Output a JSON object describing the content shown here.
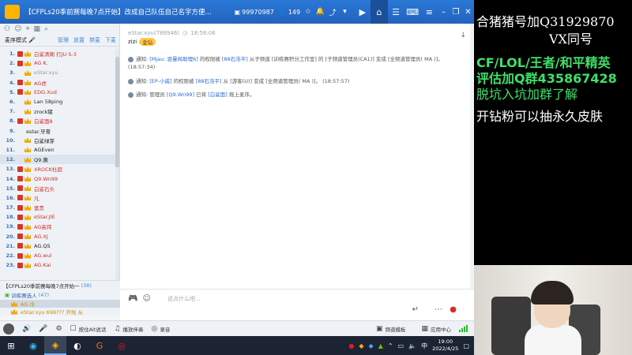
{
  "titlebar": {
    "title": "【CFPLs20季前赛每晚7点开始】改成自己队伍自己名字方便...",
    "channel_id": "99970987",
    "users": "149"
  },
  "left": {
    "mode_label": "麦序模式",
    "actions": [
      "管理",
      "放置",
      "禁麦",
      "下麦"
    ],
    "members": [
      {
        "num": "1.",
        "badge": true,
        "crown": true,
        "name": "白鲨清阁 打JU S-3",
        "color": "red"
      },
      {
        "num": "2.",
        "badge": true,
        "crown": true,
        "name": "AG K.",
        "color": "red"
      },
      {
        "num": "3.",
        "badge": false,
        "crown": true,
        "name": "eStar.xyu",
        "color": "gry"
      },
      {
        "num": "4.",
        "badge": true,
        "crown": true,
        "name": "AG虎",
        "color": "red"
      },
      {
        "num": "5.",
        "badge": true,
        "crown": true,
        "name": "EDG.Xud",
        "color": "red"
      },
      {
        "num": "6.",
        "badge": false,
        "crown": true,
        "name": "Lan 58ping",
        "color": "blk"
      },
      {
        "num": "7.",
        "badge": false,
        "crown": true,
        "name": "zrock猪",
        "color": "blk"
      },
      {
        "num": "8.",
        "badge": true,
        "crown": true,
        "name": "白鲨面8",
        "color": "red"
      },
      {
        "num": "9.",
        "badge": false,
        "crown": false,
        "name": "estar.牙膏",
        "color": "blk",
        "indent": true
      },
      {
        "num": "10.",
        "badge": false,
        "crown": true,
        "name": "白鲨绿芽",
        "color": "blk"
      },
      {
        "num": "11.",
        "badge": false,
        "crown": true,
        "name": "AGEven",
        "color": "blk"
      },
      {
        "num": "12.",
        "badge": false,
        "crown": true,
        "name": "Q9.黄",
        "color": "blk",
        "sel": true
      },
      {
        "num": "13.",
        "badge": true,
        "crown": true,
        "name": "XROCK杜超",
        "color": "red"
      },
      {
        "num": "14.",
        "badge": true,
        "crown": true,
        "name": "Q9.Wn99",
        "color": "red"
      },
      {
        "num": "15.",
        "badge": true,
        "crown": true,
        "name": "白鲨石头",
        "color": "red"
      },
      {
        "num": "16.",
        "badge": true,
        "crown": true,
        "name": "凡",
        "color": "red"
      },
      {
        "num": "17.",
        "badge": true,
        "crown": true,
        "name": "富贵",
        "color": "red"
      },
      {
        "num": "18.",
        "badge": true,
        "crown": true,
        "name": "eStar.JIE",
        "color": "red"
      },
      {
        "num": "19.",
        "badge": true,
        "crown": true,
        "name": "AG高炜",
        "color": "red"
      },
      {
        "num": "20.",
        "badge": true,
        "crown": true,
        "name": "AG.XJ",
        "color": "red"
      },
      {
        "num": "21.",
        "badge": true,
        "crown": true,
        "name": "AG.QS",
        "color": "blk"
      },
      {
        "num": "22.",
        "badge": true,
        "crown": true,
        "name": "AG.wul",
        "color": "red"
      },
      {
        "num": "23.",
        "badge": true,
        "crown": true,
        "name": "AG.Kai",
        "color": "red"
      }
    ],
    "sub_channel": {
      "name": "【CFPLs20季前赛每晚7点开始一",
      "count": "(38)"
    },
    "sub_channel2": {
      "name": "训练赛选人",
      "count": "(47)"
    },
    "sub_users": [
      {
        "name": "AG.冷",
        "sel": true
      },
      {
        "name": "eStar.xyu  699???  开始 从",
        "sel": false
      }
    ]
  },
  "chat": {
    "sender": "eStar.xyu(788946)",
    "time": "18:56:06",
    "msg_name": "zizi",
    "vip": "金钻",
    "notices": [
      {
        "pre": "通知: ",
        "parts": [
          [
            "[Mjau: 恩曼局助理6]",
            "hl"
          ],
          [
            " 的权限被 ",
            ""
          ],
          [
            "[88石浩平]",
            "hl"
          ],
          [
            " 从子频道 [训练赛积分工作室] 的 [子频道管理员(CA1)] 变成 [全频道管理员( MA )]。 (18:57:34)",
            ""
          ]
        ]
      },
      {
        "pre": "通知: ",
        "parts": [
          [
            "[EP-小威]",
            "hl"
          ],
          [
            " 的权限被 ",
            ""
          ],
          [
            "[88石浩平]",
            "hl"
          ],
          [
            " 从 [游客(U)] 变成 [全频道管理员( MA )]。 (18:57:57)",
            ""
          ]
        ]
      },
      {
        "pre": "通知: ",
        "parts": [
          [
            "管理员 ",
            ""
          ],
          [
            "[Q9.Wn99]",
            "hl"
          ],
          [
            " 已将 ",
            ""
          ],
          [
            "[白鲨面]",
            "hl"
          ],
          [
            " 拖上麦序。",
            ""
          ]
        ]
      }
    ]
  },
  "input": {
    "placeholder": "说点什么吧..."
  },
  "bottombar": {
    "hotkey": "按住Alt说话",
    "music": "播放伴奏",
    "record": "录音",
    "mode": "频道模板",
    "app": "应用中心"
  },
  "taskbar": {
    "time": "19:00",
    "date": "2022/4/25"
  },
  "overlay": {
    "lines": [
      {
        "text": "合猪猪号加Q31929870",
        "style": "w"
      },
      {
        "text": "VX同号",
        "style": "w"
      },
      {
        "text": "CF/LOL/王者/和平精英",
        "style": "g"
      },
      {
        "text": "评估加Q群435867428",
        "style": "g"
      },
      {
        "text": "脱坑入坑加群了解",
        "style": "gs"
      },
      {
        "text": "开钻粉可以抽永久皮肤",
        "style": "w"
      }
    ]
  },
  "colors": {
    "accent": "#2a78d6",
    "red": "#d0302a",
    "overlay_green": "#3fe06a"
  }
}
